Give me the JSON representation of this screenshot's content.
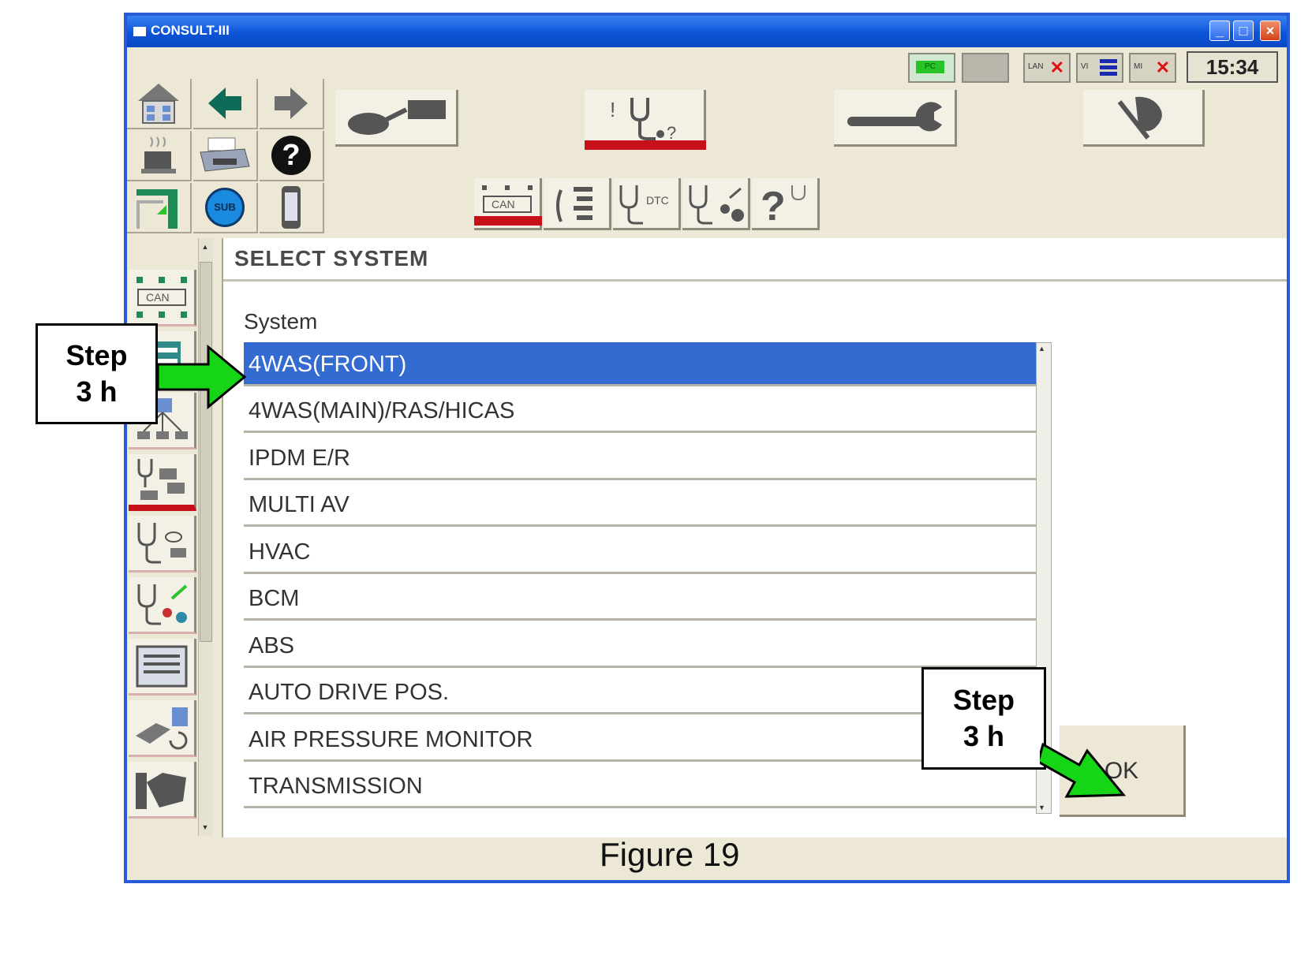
{
  "window": {
    "title": "CONSULT-III",
    "minimize": "_",
    "maximize": "□",
    "close": "×"
  },
  "statusbar": {
    "pc": "PC",
    "lan": "LAN",
    "vi": "VI",
    "mi": "MI",
    "clock": "15:34"
  },
  "toolbar": {
    "help": "?",
    "sub": "SUB",
    "can": "CAN",
    "dtc": "DTC"
  },
  "panel": {
    "title": "SELECT SYSTEM",
    "system_label": "System",
    "systems": [
      "4WAS(FRONT)",
      "4WAS(MAIN)/RAS/HICAS",
      "IPDM E/R",
      "MULTI AV",
      "HVAC",
      "BCM",
      "ABS",
      "AUTO DRIVE POS.",
      "AIR PRESSURE MONITOR",
      "TRANSMISSION"
    ],
    "selected_index": 0,
    "ok": "OK"
  },
  "annotations": {
    "step_left": {
      "line1": "Step",
      "line2": "3 h"
    },
    "step_right": {
      "line1": "Step",
      "line2": "3 h"
    },
    "arrow_color": "#16d416"
  },
  "caption": "Figure 19"
}
